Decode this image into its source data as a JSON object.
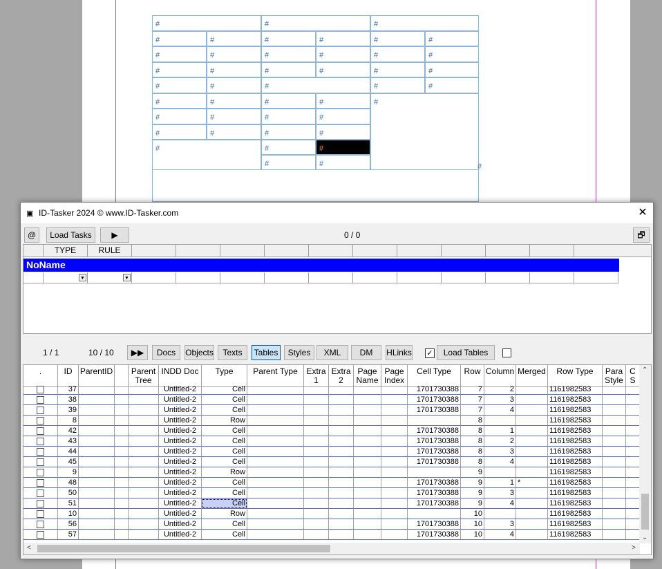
{
  "indesign": {
    "cell_marker": "#"
  },
  "window": {
    "title": "ID-Tasker 2024  © www.ID-Tasker.com",
    "close_glyph": "✕"
  },
  "toolbar": {
    "at_label": "@",
    "load_tasks_label": "Load Tasks",
    "play_glyph": "▶",
    "task_counter": "0 / 0",
    "restore_glyph": "🗗"
  },
  "task_grid": {
    "headers": [
      "",
      "TYPE",
      "RULE",
      "",
      "",
      "",
      "",
      "",
      "",
      "",
      "",
      "",
      "",
      ""
    ],
    "group_name": "NoName"
  },
  "lower_toolbar": {
    "page_counter": "1 / 1",
    "item_counter": "10 / 10",
    "ff_glyph": "▶▶",
    "tabs": [
      "Docs",
      "Objects",
      "Texts",
      "Tables",
      "Styles",
      "XML",
      "DM",
      "HLinks"
    ],
    "active_tab": "Tables",
    "checkbox1_checked": "✓",
    "load_tables_label": "Load Tables"
  },
  "data_grid": {
    "headers": [
      ".",
      "ID",
      "ParentID",
      "",
      "Parent Tree",
      "INDD Doc",
      "Type",
      "Parent Type",
      "Extra 1",
      "Extra 2",
      "Page Name",
      "Page Index",
      "Cell Type",
      "Row",
      "Column",
      "Merged",
      "Row Type",
      "Para Style",
      "C S"
    ],
    "rows": [
      {
        "id": "37",
        "doc": "Untitled-2",
        "type": "Cell",
        "cell_type": "1701730388",
        "row": "7",
        "col": "2",
        "merged": "",
        "row_type": "1161982583"
      },
      {
        "id": "38",
        "doc": "Untitled-2",
        "type": "Cell",
        "cell_type": "1701730388",
        "row": "7",
        "col": "3",
        "merged": "",
        "row_type": "1161982583"
      },
      {
        "id": "39",
        "doc": "Untitled-2",
        "type": "Cell",
        "cell_type": "1701730388",
        "row": "7",
        "col": "4",
        "merged": "",
        "row_type": "1161982583"
      },
      {
        "id": "8",
        "doc": "Untitled-2",
        "type": "Row",
        "cell_type": "",
        "row": "8",
        "col": "",
        "merged": "",
        "row_type": "1161982583"
      },
      {
        "id": "42",
        "doc": "Untitled-2",
        "type": "Cell",
        "cell_type": "1701730388",
        "row": "8",
        "col": "1",
        "merged": "",
        "row_type": "1161982583"
      },
      {
        "id": "43",
        "doc": "Untitled-2",
        "type": "Cell",
        "cell_type": "1701730388",
        "row": "8",
        "col": "2",
        "merged": "",
        "row_type": "1161982583"
      },
      {
        "id": "44",
        "doc": "Untitled-2",
        "type": "Cell",
        "cell_type": "1701730388",
        "row": "8",
        "col": "3",
        "merged": "",
        "row_type": "1161982583"
      },
      {
        "id": "45",
        "doc": "Untitled-2",
        "type": "Cell",
        "cell_type": "1701730388",
        "row": "8",
        "col": "4",
        "merged": "",
        "row_type": "1161982583"
      },
      {
        "id": "9",
        "doc": "Untitled-2",
        "type": "Row",
        "cell_type": "",
        "row": "9",
        "col": "",
        "merged": "",
        "row_type": "1161982583"
      },
      {
        "id": "48",
        "doc": "Untitled-2",
        "type": "Cell",
        "cell_type": "1701730388",
        "row": "9",
        "col": "1",
        "merged": "*",
        "row_type": "1161982583"
      },
      {
        "id": "50",
        "doc": "Untitled-2",
        "type": "Cell",
        "cell_type": "1701730388",
        "row": "9",
        "col": "3",
        "merged": "",
        "row_type": "1161982583"
      },
      {
        "id": "51",
        "doc": "Untitled-2",
        "type": "Cell",
        "cell_type": "1701730388",
        "row": "9",
        "col": "4",
        "merged": "",
        "row_type": "1161982583",
        "selected": true
      },
      {
        "id": "10",
        "doc": "Untitled-2",
        "type": "Row",
        "cell_type": "",
        "row": "10",
        "col": "",
        "merged": "",
        "row_type": "1161982583"
      },
      {
        "id": "56",
        "doc": "Untitled-2",
        "type": "Cell",
        "cell_type": "1701730388",
        "row": "10",
        "col": "3",
        "merged": "",
        "row_type": "1161982583"
      },
      {
        "id": "57",
        "doc": "Untitled-2",
        "type": "Cell",
        "cell_type": "1701730388",
        "row": "10",
        "col": "4",
        "merged": "",
        "row_type": "1161982583"
      }
    ]
  },
  "scroll": {
    "up": "⌃",
    "down": "⌄",
    "left": "<",
    "right": ">"
  },
  "colors": {
    "noname_bg": "#0000ff",
    "selected_cell_bg": "#000000",
    "marker_color": "#3f6ea8"
  }
}
